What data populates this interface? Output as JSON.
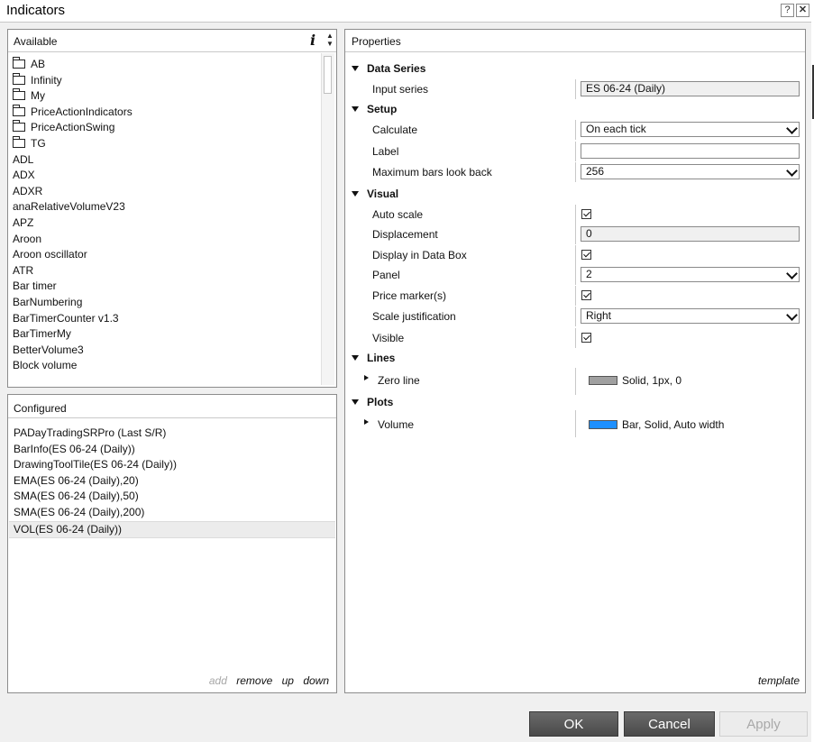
{
  "window": {
    "title": "Indicators",
    "help_label": "?",
    "close_label": "✕"
  },
  "available": {
    "header": "Available",
    "info_label": "i",
    "folders": [
      "AB",
      "Infinity",
      "My",
      "PriceActionIndicators",
      "PriceActionSwing",
      "TG"
    ],
    "items": [
      "ADL",
      "ADX",
      "ADXR",
      "anaRelativeVolumeV23",
      "APZ",
      "Aroon",
      "Aroon oscillator",
      "ATR",
      "Bar timer",
      "BarNumbering",
      "BarTimerCounter v1.3",
      "BarTimerMy",
      "BetterVolume3",
      "Block volume"
    ]
  },
  "configured": {
    "header": "Configured",
    "items": [
      "PADayTradingSRPro  (Last S/R)",
      "BarInfo(ES 06-24 (Daily))",
      "DrawingToolTile(ES 06-24 (Daily))",
      "EMA(ES 06-24 (Daily),20)",
      "SMA(ES 06-24 (Daily),50)",
      "SMA(ES 06-24 (Daily),200)",
      "VOL(ES 06-24 (Daily))"
    ],
    "selected_index": 6,
    "actions": {
      "add": "add",
      "remove": "remove",
      "up": "up",
      "down": "down"
    }
  },
  "properties": {
    "header": "Properties",
    "template_label": "template",
    "data_series": {
      "title": "Data Series",
      "input_series_label": "Input series",
      "input_series_value": "ES 06-24 (Daily)"
    },
    "setup": {
      "title": "Setup",
      "calculate_label": "Calculate",
      "calculate_value": "On each tick",
      "label_label": "Label",
      "label_value": "",
      "max_bars_label": "Maximum bars look back",
      "max_bars_value": "256"
    },
    "visual": {
      "title": "Visual",
      "auto_scale_label": "Auto scale",
      "auto_scale_checked": true,
      "displacement_label": "Displacement",
      "displacement_value": "0",
      "data_box_label": "Display in Data Box",
      "data_box_checked": true,
      "panel_label": "Panel",
      "panel_value": "2",
      "price_marker_label": "Price marker(s)",
      "price_marker_checked": true,
      "scale_just_label": "Scale justification",
      "scale_just_value": "Right",
      "visible_label": "Visible",
      "visible_checked": true
    },
    "lines": {
      "title": "Lines",
      "zero_line_label": "Zero line",
      "zero_line_value": "Solid, 1px, 0",
      "zero_line_color": "#a0a0a0"
    },
    "plots": {
      "title": "Plots",
      "volume_label": "Volume",
      "volume_value": "Bar, Solid, Auto width",
      "volume_color": "#1e90ff"
    }
  },
  "buttons": {
    "ok": "OK",
    "cancel": "Cancel",
    "apply": "Apply"
  }
}
